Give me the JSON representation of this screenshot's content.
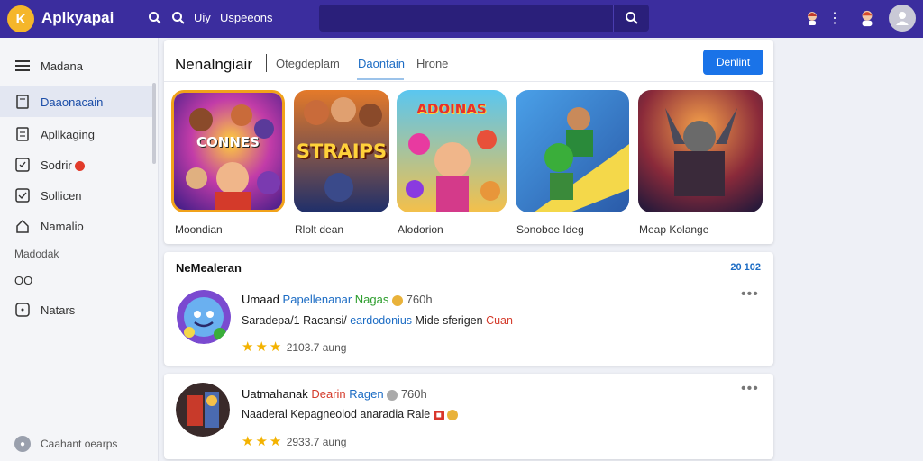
{
  "app": {
    "title": "Aplkyapai",
    "logo_letter": "K",
    "brand_color": "#3b2d9e",
    "accent_color": "#1a73e8"
  },
  "topbar": {
    "links": [
      "Uiy",
      "Uspeeons"
    ],
    "search_placeholder": "",
    "icons": [
      "search-icon",
      "search-icon",
      "search-icon",
      "notification-icon",
      "more-vertical-icon",
      "profile-icon",
      "avatar"
    ]
  },
  "sidebar": {
    "items": [
      {
        "label": "Madana",
        "icon": "menu-icon",
        "active": false
      },
      {
        "label": "Daaonacain",
        "icon": "bookmark-icon",
        "active": true
      },
      {
        "label": "Apllkaging",
        "icon": "document-icon",
        "active": false
      },
      {
        "label": "Sodrir",
        "icon": "message-icon",
        "active": false,
        "badge": true
      },
      {
        "label": "Sollicen",
        "icon": "check-icon",
        "active": false
      },
      {
        "label": "Namalio",
        "icon": "home-icon",
        "active": false
      }
    ],
    "section_label": "Madodak",
    "section_icon_text": "OO",
    "extra_item": {
      "label": "Natars",
      "icon": "add-icon"
    },
    "footer": {
      "label": "Caahant oearps",
      "icon": "account-circle-icon"
    }
  },
  "featured": {
    "title": "Nenalngiair",
    "tabs": [
      {
        "label": "Otegdeplam",
        "active": false
      },
      {
        "label": "Daontain",
        "active": true
      },
      {
        "label": "Hrone",
        "active": false
      }
    ],
    "action_button": "Denlint",
    "games": [
      {
        "label": "Moondian",
        "art_title": "CONNES",
        "selected": true
      },
      {
        "label": "Rlolt dean",
        "art_title": "STRAIPS",
        "selected": false
      },
      {
        "label": "Alodorion",
        "art_title": "ADOINAS",
        "selected": false
      },
      {
        "label": "Sonoboe Ideg",
        "art_title": "",
        "selected": false
      },
      {
        "label": "Meap Kolange",
        "art_title": "",
        "selected": false
      }
    ]
  },
  "feed": {
    "title": "NeMealeran",
    "count": "20 102",
    "posts": [
      {
        "author": "Umaad",
        "tag1": "Papellenanar",
        "tag2": "Nagas",
        "time": "760h",
        "text_main": "Saradepa/1 Racansi/",
        "text_accent": "eardodonius",
        "text_tail": "Mide sferigen",
        "text_end": "Cuan",
        "rating_text": "2103.7 aung",
        "stars": 3
      },
      {
        "author": "Uatmahanak",
        "tag1": "Dearin",
        "tag2": "Ragen",
        "time": "760h",
        "text_main": "Naaderal",
        "text_accent": "Kepagneolod",
        "text_tail": "anaradia Rale",
        "text_end": "",
        "rating_text": "2933.7 aung",
        "stars": 3
      }
    ]
  }
}
